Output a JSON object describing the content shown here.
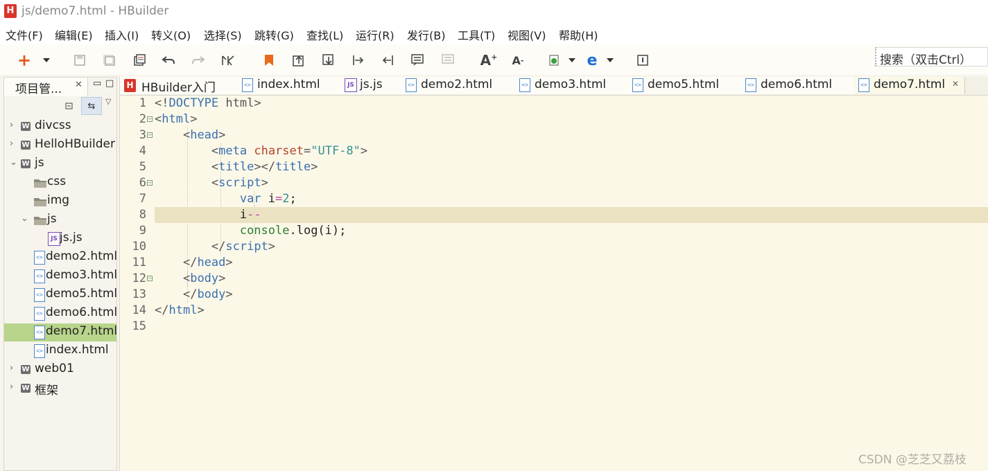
{
  "window": {
    "logo": "H",
    "title": "js/demo7.html  -  HBuilder"
  },
  "menu": [
    "文件(F)",
    "编辑(E)",
    "插入(I)",
    "转义(O)",
    "选择(S)",
    "跳转(G)",
    "查找(L)",
    "运行(R)",
    "发行(B)",
    "工具(T)",
    "视图(V)",
    "帮助(H)"
  ],
  "toolbar": {
    "new_label": "+",
    "icons": [
      "new-icon",
      "save-icon",
      "save-all-icon",
      "copy-icon",
      "undo-icon",
      "redo-icon",
      "format-icon",
      "bookmark-icon",
      "goto-top-icon",
      "goto-bottom-icon",
      "indent-icon",
      "outdent-icon",
      "comment-icon",
      "uncomment-icon",
      "font-increase-icon",
      "font-decrease-icon",
      "run-browser-icon",
      "ie-icon",
      "terminal-icon"
    ],
    "font_up": "A",
    "font_down": "A",
    "ie": "e",
    "search_label": "搜索（双击Ctrl）"
  },
  "project_panel": {
    "tab_label": "项目管...",
    "tree": [
      {
        "label": "divcss",
        "type": "project",
        "expanded": false,
        "depth": 0
      },
      {
        "label": "HelloHBuilder",
        "type": "project",
        "expanded": false,
        "depth": 0
      },
      {
        "label": "js",
        "type": "project",
        "expanded": true,
        "depth": 0
      },
      {
        "label": "css",
        "type": "folder",
        "depth": 1
      },
      {
        "label": "img",
        "type": "folder",
        "depth": 1
      },
      {
        "label": "js",
        "type": "folder",
        "expanded": true,
        "depth": 1
      },
      {
        "label": "js.js",
        "type": "js",
        "depth": 2
      },
      {
        "label": "demo2.html",
        "type": "html",
        "depth": 1
      },
      {
        "label": "demo3.html",
        "type": "html",
        "depth": 1
      },
      {
        "label": "demo5.html",
        "type": "html",
        "depth": 1
      },
      {
        "label": "demo6.html",
        "type": "html",
        "depth": 1
      },
      {
        "label": "demo7.html",
        "type": "html",
        "depth": 1,
        "selected": true
      },
      {
        "label": "index.html",
        "type": "html",
        "depth": 1
      },
      {
        "label": "web01",
        "type": "project",
        "expanded": false,
        "depth": 0
      },
      {
        "label": "框架",
        "type": "project",
        "expanded": false,
        "depth": 0
      }
    ]
  },
  "tabs": [
    {
      "label": "HBuilder入门",
      "icon": "hbuilder-icon"
    },
    {
      "label": "index.html",
      "icon": "html-file-icon"
    },
    {
      "label": "js.js",
      "icon": "js-file-icon"
    },
    {
      "label": "demo2.html",
      "icon": "html-file-icon"
    },
    {
      "label": "demo3.html",
      "icon": "html-file-icon"
    },
    {
      "label": "demo5.html",
      "icon": "html-file-icon"
    },
    {
      "label": "demo6.html",
      "icon": "html-file-icon"
    },
    {
      "label": "demo7.html",
      "icon": "html-file-icon",
      "active": true
    }
  ],
  "code": {
    "current_line": 8,
    "lines": [
      "1",
      "2",
      "3",
      "4",
      "5",
      "6",
      "7",
      "8",
      "9",
      "10",
      "11",
      "12",
      "13",
      "14",
      "15"
    ],
    "text": {
      "l1a": "<!",
      "l1b": "DOCTYPE",
      "l1c": " html>",
      "l2a": "<",
      "l2b": "html",
      "l2c": ">",
      "l3b": "head",
      "l4b": "meta",
      "l4attr": "charset",
      "l4eq": "=",
      "l4str": "\"UTF-8\"",
      "l5b": "title",
      "l5d": "</",
      "l5e": "title",
      "l6b": "script",
      "l7kw": "var",
      "l7var": " i",
      "l7op": "=",
      "l7num": "2",
      "l7end": ";",
      "l8var": "i",
      "l8op": "--",
      "l9fn": "console",
      "l9rest": ".log(i);",
      "l10b": "script",
      "l11b": "head",
      "l12b": "body",
      "l13b": "body",
      "l14b": "html"
    }
  },
  "watermark": "CSDN @芝芝又荔枝"
}
